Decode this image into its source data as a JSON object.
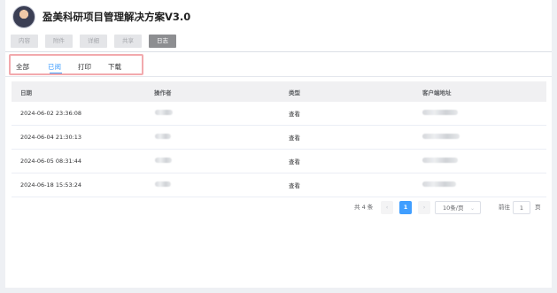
{
  "title": "盈美科研项目管理解决方案V3.0",
  "top_tabs": [
    "内容",
    "附件",
    "详细",
    "共享",
    "日志"
  ],
  "top_tabs_active": "日志",
  "sub_tabs": [
    "全部",
    "已阅",
    "打印",
    "下载"
  ],
  "sub_tabs_active": "已阅",
  "table": {
    "headers": [
      "日期",
      "操作者",
      "类型",
      "客户端地址"
    ],
    "rows": [
      {
        "date": "2024-06-02 23:36:08",
        "type": "查看"
      },
      {
        "date": "2024-06-04 21:30:13",
        "type": "查看"
      },
      {
        "date": "2024-06-05 08:31:44",
        "type": "查看"
      },
      {
        "date": "2024-06-18 15:53:24",
        "type": "查看"
      }
    ]
  },
  "pagination": {
    "total_label": "共 4 条",
    "prev": "‹",
    "current_page": "1",
    "next": "›",
    "page_size": "10条/页",
    "goto_prefix": "前往",
    "goto_value": "1",
    "goto_suffix": "页"
  },
  "colors": {
    "accent": "#409eff",
    "highlight_border": "#f2a9ad",
    "active_tab_bg": "#8d8e91"
  }
}
